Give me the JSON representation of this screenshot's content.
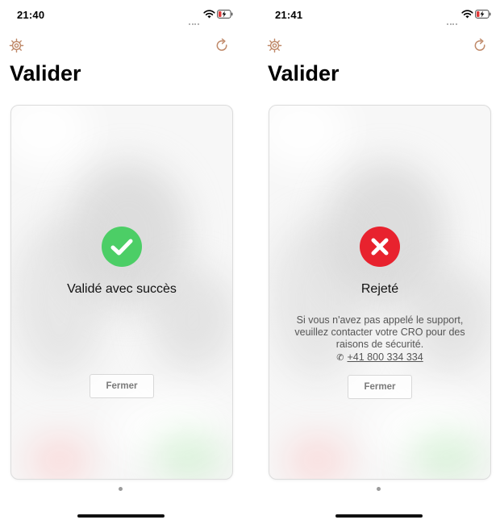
{
  "colors": {
    "accent_icon": "#c08a6a",
    "success": "#4cce66",
    "error": "#e8222e"
  },
  "icons": {
    "settings": "gear-icon",
    "refresh": "refresh-icon",
    "success": "checkmark-icon",
    "error": "close-x-icon",
    "phone": "phone-icon"
  },
  "screens": [
    {
      "status_bar": {
        "time": "21:40"
      },
      "title": "Valider",
      "result": {
        "state": "success",
        "message": "Validé avec succès"
      },
      "close_label": "Fermer"
    },
    {
      "status_bar": {
        "time": "21:41"
      },
      "title": "Valider",
      "result": {
        "state": "error",
        "message": "Rejeté",
        "details": "Si vous n'avez pas appelé le support, veuillez contacter votre CRO pour des raisons de sécurité.",
        "phone_icon": "✆",
        "phone_number": "+41 800 334 334"
      },
      "close_label": "Fermer"
    }
  ]
}
